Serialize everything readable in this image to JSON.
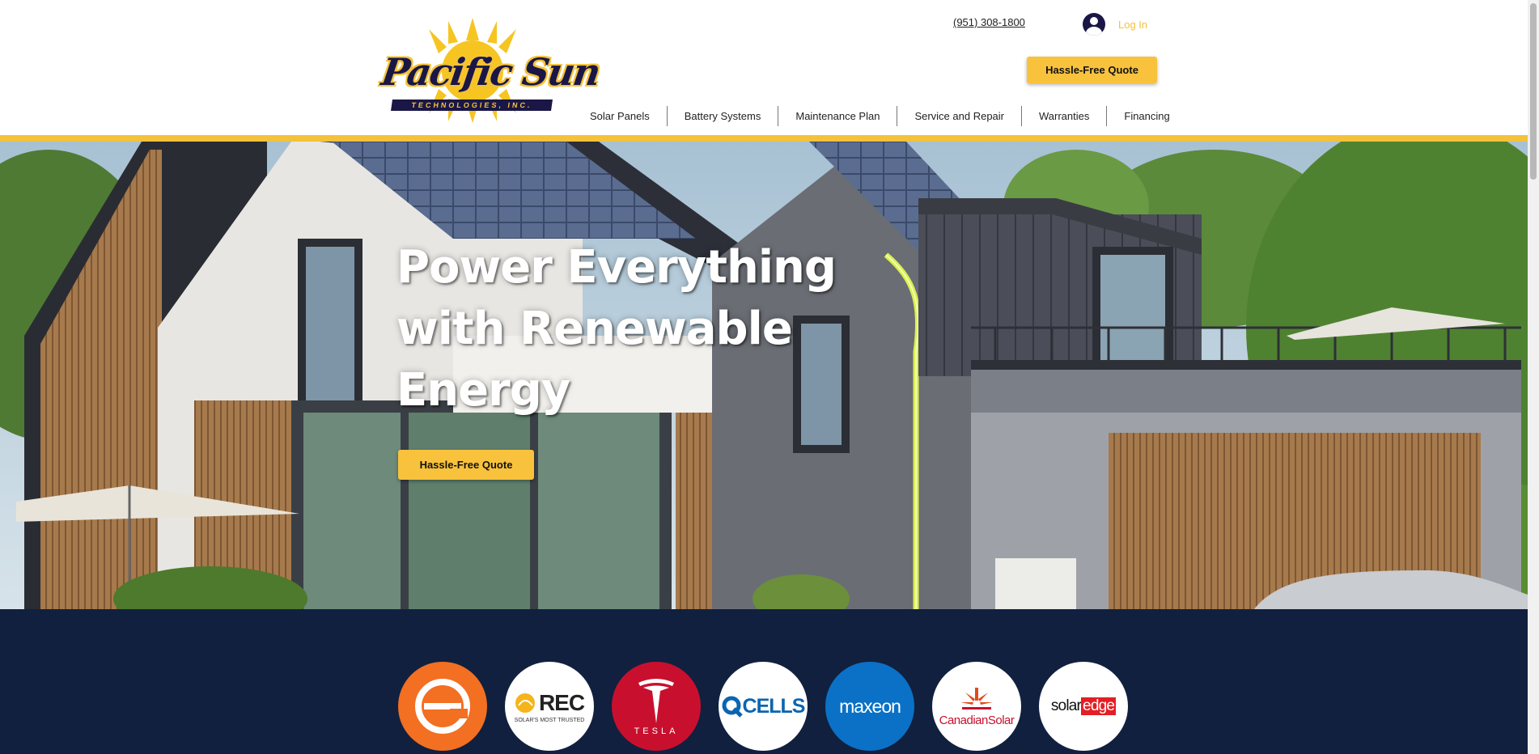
{
  "header": {
    "logo": {
      "name": "Pacific Sun",
      "sub": "TECHNOLOGIES, INC."
    },
    "phone": "(951) 308-1800",
    "login_label": "Log In",
    "quote_button": "Hassle-Free Quote",
    "nav": [
      "Solar Panels",
      "Battery Systems",
      "Maintenance Plan",
      "Service and Repair",
      "Warranties",
      "Financing"
    ]
  },
  "hero": {
    "title_lines": [
      "Power Everything",
      "with Renewable",
      "Energy"
    ],
    "cta": "Hassle-Free Quote"
  },
  "brands": {
    "rec": {
      "word": "REC",
      "tagline": "SOLAR'S MOST TRUSTED"
    },
    "tesla": "TESLA",
    "qcells": "CELLS",
    "maxeon": "maxeon",
    "canadian_solar": "CanadianSolar",
    "solaredge": {
      "a": "solar",
      "b": "edge"
    }
  },
  "colors": {
    "accent_yellow": "#f4c13b",
    "navy": "#11203f",
    "logo_navy": "#1a1746"
  },
  "icons": [
    "sun-icon",
    "avatar-icon",
    "enphase-logo-icon",
    "rec-sun-icon",
    "tesla-t-icon",
    "canadian-solar-leaf-icon"
  ]
}
